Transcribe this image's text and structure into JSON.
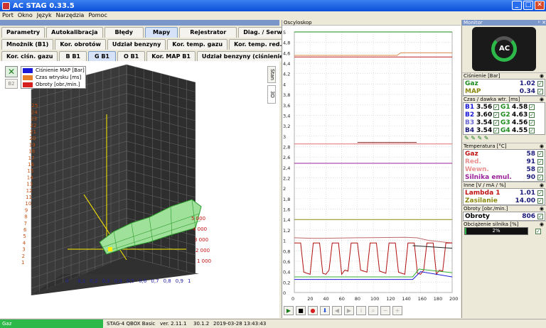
{
  "window": {
    "title": "AC STAG 0.33.5"
  },
  "menu": [
    "Port",
    "Okno",
    "Język",
    "Narzędzia",
    "Pomoc"
  ],
  "tabs_row1": [
    "Parametry",
    "Autokalibracja",
    "Błędy",
    "Mapy",
    "Rejestrator",
    "Diag. / Serw."
  ],
  "tabs_row2": [
    "Mnożnik (B1)",
    "Kor. obrotów",
    "Udział benzyny",
    "Kor. temp. gazu",
    "Kor. temp. red."
  ],
  "tabs_row3": [
    "Kor. ciśn. gazu",
    "B B1",
    "G B1",
    "O B1",
    "Kor. MAP B1",
    "Udział benzyny (ciśnienie gazu)"
  ],
  "selected": {
    "row1": "Mapy",
    "row3": "G B1"
  },
  "sidetabs": [
    "Stan",
    "3D"
  ],
  "b2_label": "B2",
  "legend": [
    {
      "label": "Ciśnienie MAP [Bar]",
      "color": "#1a1ad6"
    },
    {
      "label": "Czas wtrysku [ms]",
      "color": "#e8802a"
    },
    {
      "label": "Obroty [obr./min.]",
      "color": "#d62020"
    }
  ],
  "plot3d": {
    "x_ticks": [
      "0",
      "0,1",
      "0,2",
      "0,3",
      "0,4",
      "0,5",
      "0,6",
      "0,7",
      "0,8",
      "0,9",
      "1"
    ],
    "y_ticks": [
      "1",
      "2",
      "3",
      "4",
      "5",
      "6",
      "7",
      "8",
      "9",
      "10",
      "11",
      "12",
      "13",
      "14",
      "15",
      "16",
      "17",
      "18",
      "19",
      "20",
      "21",
      "22",
      "23",
      "24",
      "25"
    ],
    "rpm_ticks": [
      "1 000",
      "2 000",
      "3 000",
      "4 000",
      "5 000"
    ]
  },
  "scope": {
    "title": "Oscyloskop",
    "y_ticks": [
      "0",
      "0,2",
      "0,4",
      "0,6",
      "0,8",
      "1",
      "1,2",
      "1,4",
      "1,6",
      "1,8",
      "2",
      "2,2",
      "2,4",
      "2,6",
      "2,8",
      "3",
      "3,2",
      "3,4",
      "3,6",
      "3,8",
      "4",
      "4,2",
      "4,4",
      "4,6",
      "4,8",
      "5"
    ],
    "x_ticks": [
      "0",
      "20",
      "40",
      "60",
      "80",
      "100",
      "120",
      "140",
      "160",
      "180",
      "200"
    ]
  },
  "monitor": {
    "title": "Monitor",
    "pressure_head": "Ciśnienie [Bar]",
    "pressure": [
      {
        "label": "Gaz",
        "value": "1.02",
        "color": "#1a8a1a"
      },
      {
        "label": "MAP",
        "value": "0.34",
        "color": "#8a8a10"
      }
    ],
    "inj_head": "Czas / dawka wtr. [ms]",
    "inj": [
      {
        "b": "B1",
        "bv": "3.56",
        "g": "G1",
        "gv": "4.58"
      },
      {
        "b": "B2",
        "bv": "3.60",
        "g": "G2",
        "gv": "4.63"
      },
      {
        "b": "B3",
        "bv": "3.54",
        "g": "G3",
        "gv": "4.56"
      },
      {
        "b": "B4",
        "bv": "3.54",
        "g": "G4",
        "gv": "4.55"
      }
    ],
    "temp_head": "Temperatura [°C]",
    "temps": [
      {
        "label": "Gaz",
        "value": "58",
        "color": "#c01010"
      },
      {
        "label": "Red.",
        "value": "91",
        "color": "#e89090"
      },
      {
        "label": "Wewn.",
        "value": "58",
        "color": "#e89090"
      },
      {
        "label": "Silnika emul.",
        "value": "90",
        "color": "#9a209a"
      }
    ],
    "other_head": "Inne [V / mA / %]",
    "other": [
      {
        "label": "Lambda 1",
        "value": "1.01",
        "color": "#c01010"
      },
      {
        "label": "Zasilanie",
        "value": "14.00",
        "color": "#8a8a10"
      }
    ],
    "rpm_head": "Obroty [obr./min.]",
    "rpm": {
      "label": "Obroty",
      "value": "806"
    },
    "load_head": "Obciążenie silnika [%]",
    "load": {
      "value": "2%",
      "fraction": 0.02
    }
  },
  "status": {
    "left": "Gaz",
    "device": "STAG-4 QBOX Basic",
    "ver": "ver. 2.11.1",
    "fw": "30.1.2",
    "datetime": "2019-03-28 13:43:43"
  }
}
